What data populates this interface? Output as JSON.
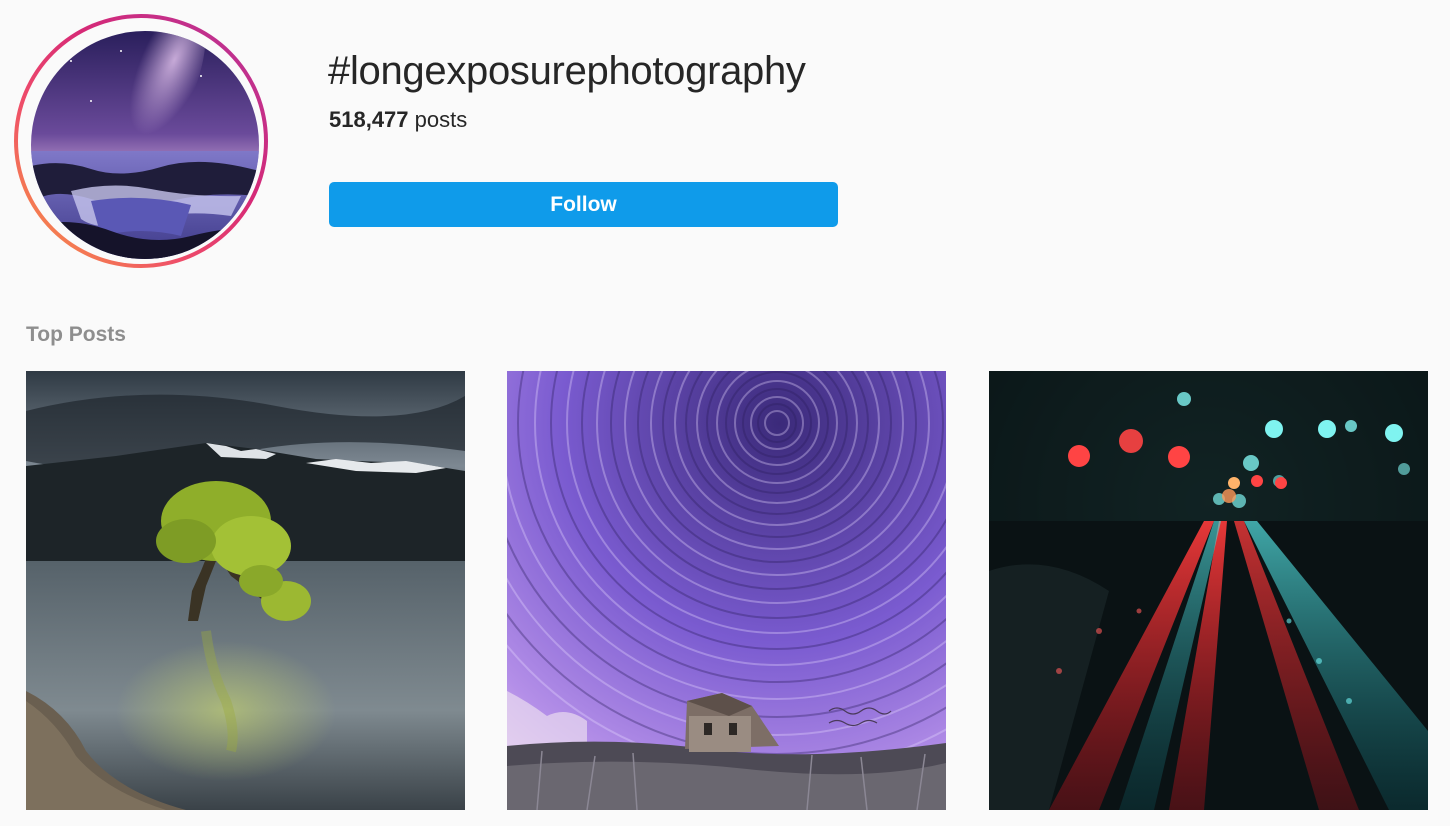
{
  "hashtag": {
    "title": "#longexposurephotography",
    "post_count": "518,477",
    "post_count_label": "posts",
    "follow_label": "Follow"
  },
  "top_posts": {
    "label": "Top Posts",
    "items": [
      {
        "subject": "lone tree in lake with mountains"
      },
      {
        "subject": "star trails over abandoned house"
      },
      {
        "subject": "city street lights at night bokeh"
      }
    ]
  },
  "colors": {
    "follow_button": "#0f9bea",
    "section_label": "#8e8e8e",
    "background": "#fafafa"
  }
}
